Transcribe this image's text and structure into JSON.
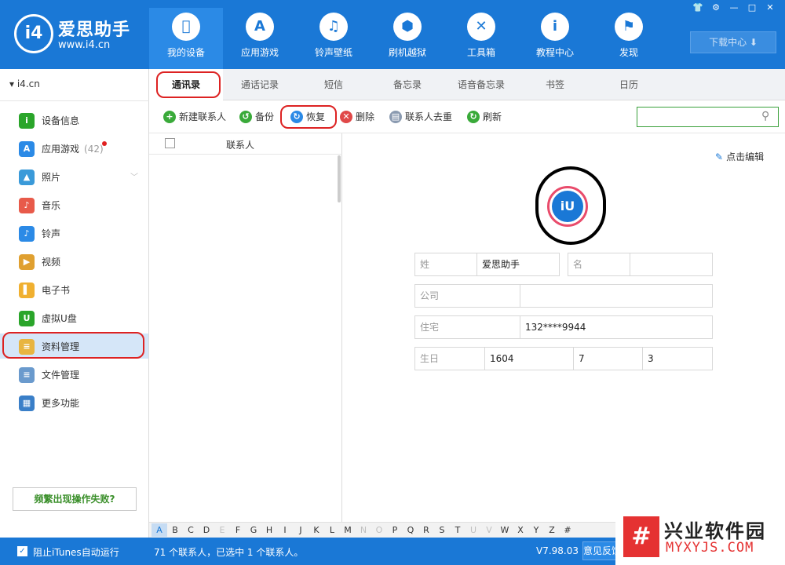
{
  "app": {
    "name": "爱思助手",
    "url": "www.i4.cn",
    "badge": "i4"
  },
  "nav": [
    {
      "label": "我的设备",
      "icon": "apple-icon",
      "glyph": ""
    },
    {
      "label": "应用游戏",
      "icon": "app-store-icon",
      "glyph": "A"
    },
    {
      "label": "铃声壁纸",
      "icon": "ringtone-wallpaper-icon",
      "glyph": "♫"
    },
    {
      "label": "刷机越狱",
      "icon": "flash-jailbreak-icon",
      "glyph": "⬢"
    },
    {
      "label": "工具箱",
      "icon": "toolbox-icon",
      "glyph": "✕"
    },
    {
      "label": "教程中心",
      "icon": "tutorial-icon",
      "glyph": "i"
    },
    {
      "label": "发现",
      "icon": "discover-icon",
      "glyph": "⚑"
    }
  ],
  "window_controls": [
    "👕",
    "⚙",
    "—",
    "□",
    "✕"
  ],
  "download_center": "下载中心 ⬇",
  "device": {
    "name": "i4.cn"
  },
  "sidebar": [
    {
      "label": "设备信息",
      "icon": "device-info-icon",
      "glyph": "i",
      "color": "#2aa52a"
    },
    {
      "label": "应用游戏",
      "count": "(42)",
      "icon": "apps-icon",
      "glyph": "A",
      "color": "#2b8ae6"
    },
    {
      "label": "照片",
      "icon": "photos-icon",
      "glyph": "▲",
      "color": "#3a9ad9"
    },
    {
      "label": "音乐",
      "icon": "music-icon",
      "glyph": "♪",
      "color": "#e85a4a"
    },
    {
      "label": "铃声",
      "icon": "bell-icon",
      "glyph": "♪",
      "color": "#2b8ae6"
    },
    {
      "label": "视频",
      "icon": "video-icon",
      "glyph": "▶",
      "color": "#e0a030"
    },
    {
      "label": "电子书",
      "icon": "ebook-icon",
      "glyph": "▌",
      "color": "#f0b030"
    },
    {
      "label": "虚拟U盘",
      "icon": "usb-icon",
      "glyph": "U",
      "color": "#2aa52a"
    },
    {
      "label": "资料管理",
      "icon": "data-manage-icon",
      "glyph": "≡",
      "color": "#e8b540"
    },
    {
      "label": "文件管理",
      "icon": "file-manage-icon",
      "glyph": "≡",
      "color": "#6a9acd"
    },
    {
      "label": "更多功能",
      "icon": "more-icon",
      "glyph": "▦",
      "color": "#3a7fc8"
    }
  ],
  "help_button": "频繁出现操作失败?",
  "tabs": [
    "通讯录",
    "通话记录",
    "短信",
    "备忘录",
    "语音备忘录",
    "书签",
    "日历"
  ],
  "toolbar": [
    {
      "label": "新建联系人",
      "icon": "add-contact-icon",
      "glyph": "+",
      "color": "#3aaa3a"
    },
    {
      "label": "备份",
      "icon": "backup-icon",
      "glyph": "↺",
      "color": "#3aaa3a"
    },
    {
      "label": "恢复",
      "icon": "restore-icon",
      "glyph": "↻",
      "color": "#2b8ae6"
    },
    {
      "label": "删除",
      "icon": "delete-icon",
      "glyph": "✕",
      "color": "#e04848"
    },
    {
      "label": "联系人去重",
      "icon": "dedupe-icon",
      "glyph": "▤",
      "color": "#8a9ab0"
    },
    {
      "label": "刷新",
      "icon": "refresh-icon",
      "glyph": "↻",
      "color": "#3aaa3a"
    }
  ],
  "search": {
    "placeholder": ""
  },
  "list": {
    "column_header": "联系人"
  },
  "detail": {
    "edit_label": "点击编辑",
    "last_name_label": "姓",
    "last_name": "爱思助手",
    "first_name_label": "名",
    "first_name": "",
    "company_label": "公司",
    "company": "",
    "home_label": "住宅",
    "home_phone": "132****9944",
    "birthday_label": "生日",
    "birthday_year": "1604",
    "birthday_month": "7",
    "birthday_day": "3",
    "avatar_text": "iU"
  },
  "alphabet": [
    {
      "l": "A",
      "s": "sel"
    },
    {
      "l": "B"
    },
    {
      "l": "C"
    },
    {
      "l": "D"
    },
    {
      "l": "E",
      "s": "dim"
    },
    {
      "l": "F"
    },
    {
      "l": "G"
    },
    {
      "l": "H"
    },
    {
      "l": "I"
    },
    {
      "l": "J"
    },
    {
      "l": "K"
    },
    {
      "l": "L"
    },
    {
      "l": "M"
    },
    {
      "l": "N",
      "s": "dim"
    },
    {
      "l": "O",
      "s": "dim"
    },
    {
      "l": "P"
    },
    {
      "l": "Q"
    },
    {
      "l": "R"
    },
    {
      "l": "S"
    },
    {
      "l": "T"
    },
    {
      "l": "U",
      "s": "dim"
    },
    {
      "l": "V",
      "s": "dim"
    },
    {
      "l": "W"
    },
    {
      "l": "X"
    },
    {
      "l": "Y"
    },
    {
      "l": "Z"
    },
    {
      "l": "#"
    }
  ],
  "status": {
    "itunes_block": "阻止iTunes自动运行",
    "check": "✓",
    "selection": "71 个联系人，已选中 1 个联系人。",
    "version": "V7.98.03",
    "feedback": "意见反馈"
  },
  "watermark": {
    "logo": "#",
    "name": "兴业软件园",
    "url": "MYXYJS.COM"
  },
  "colors": {
    "brand_blue": "#1a78d6",
    "highlight_red": "#dd2222",
    "selected_row": "#d5e6f8"
  }
}
